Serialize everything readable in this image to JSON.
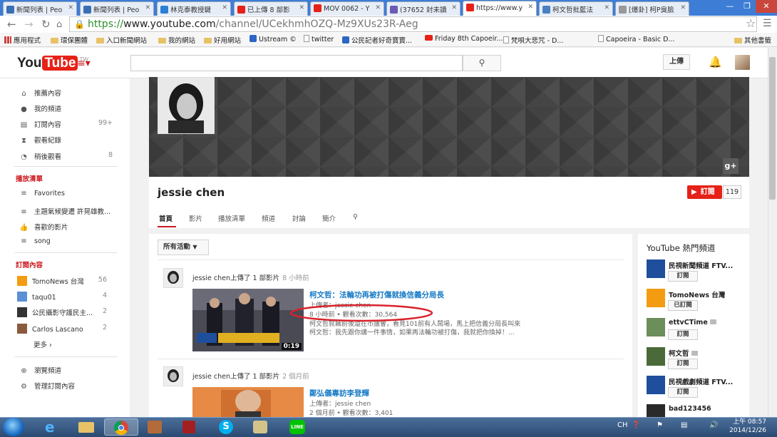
{
  "browser": {
    "tabs": [
      {
        "label": "新聞列表 | Peo",
        "color": "#3b6fb5"
      },
      {
        "label": "新聞列表 | Peo",
        "color": "#3b6fb5"
      },
      {
        "label": "林克泰教授鍵",
        "color": "#2a7fd4"
      },
      {
        "label": "已上傳 8 部影",
        "color": "#e62117"
      },
      {
        "label": "MOV 0062 - Y",
        "color": "#e62117"
      },
      {
        "label": "(37652 封未讀",
        "color": "#6b5bb5"
      },
      {
        "label": "https://www.y",
        "color": "#e62117"
      },
      {
        "label": "柯文哲批藍法",
        "color": "#4a7fc4"
      },
      {
        "label": "[爆卦] 柯P臭臉",
        "color": "#999999"
      }
    ],
    "active_tab_index": 6,
    "url_scheme": "https://",
    "url_host": "www.youtube.com",
    "url_path": "/channel/UCekhmhOZQ-Mz9XUs23R-Aeg",
    "bookmarks": [
      {
        "label": "應用程式",
        "icon": "apps-icon"
      },
      {
        "label": "環保團體",
        "icon": "folder-icon"
      },
      {
        "label": "入口新聞網站",
        "icon": "folder-icon"
      },
      {
        "label": "我的網站",
        "icon": "folder-icon"
      },
      {
        "label": "好用網站",
        "icon": "folder-icon"
      },
      {
        "label": "Ustream ©",
        "icon": "ustream-icon"
      },
      {
        "label": "twitter",
        "icon": "page-icon"
      },
      {
        "label": "公民記者好奇寶寶...",
        "icon": "ustream-icon"
      },
      {
        "label": "Friday 8th Capoeir...",
        "icon": "youtube-icon"
      },
      {
        "label": "梵唄大悲咒 - D...",
        "icon": "page-icon"
      },
      {
        "label": "Capoeira - Basic D...",
        "icon": "page-icon"
      },
      {
        "label": "其他書籤",
        "icon": "folder-icon"
      }
    ]
  },
  "youtube": {
    "logo_you": "You",
    "logo_tube": "Tube",
    "logo_region": "TW",
    "search_placeholder": "",
    "upload_label": "上傳",
    "sidebar": {
      "main_items": [
        {
          "label": "推薦內容",
          "icon": "home-icon",
          "count": ""
        },
        {
          "label": "我的頻道",
          "icon": "user-icon",
          "count": ""
        },
        {
          "label": "訂閱內容",
          "icon": "subscriptions-icon",
          "count": "99+"
        },
        {
          "label": "觀看紀錄",
          "icon": "hourglass-icon",
          "count": ""
        },
        {
          "label": "稍後觀看",
          "icon": "clock-icon",
          "count": "8"
        }
      ],
      "playlists_heading": "播放清單",
      "playlists": [
        {
          "label": "Favorites",
          "icon": "list-icon"
        },
        {
          "label": "主題氣候變遷 許晃雄教...",
          "icon": "list-icon"
        },
        {
          "label": "喜歡的影片",
          "icon": "thumbs-up-icon"
        },
        {
          "label": "song",
          "icon": "list-icon"
        }
      ],
      "subs_heading": "訂閱內容",
      "subscriptions": [
        {
          "label": "TomoNews 台灣",
          "count": "56",
          "color": "#f39c12"
        },
        {
          "label": "taqu01",
          "count": "4",
          "color": "#5b8fd6"
        },
        {
          "label": "公民攝影守護民主...",
          "count": "2",
          "color": "#333333"
        },
        {
          "label": "Carlos Lascano",
          "count": "2",
          "color": "#8b5a3c"
        }
      ],
      "more_label": "更多 ›",
      "browse_channels": "瀏覽頻道",
      "manage_subs": "管理訂閱內容"
    },
    "channel": {
      "name": "jessie chen",
      "subscribe_label": "訂閱",
      "subscriber_count": "119",
      "tabs": [
        "首頁",
        "影片",
        "播放清單",
        "頻道",
        "討論",
        "簡介"
      ],
      "activity_filter": "所有活動"
    },
    "feed": [
      {
        "actor": "jessie chen上傳了 1 部影片",
        "ago": "8 小時前",
        "title": "柯文哲：法輪功再被打傷就換信義分局長",
        "uploader": "上傳者：jessie chen",
        "stats": "8 小時前 • 觀看次數：30,564",
        "desc1": "柯文哲就職前後還在市議會，看見101前有人鬧場，馬上把信義分局長叫來",
        "desc2": "柯文哲：我先跟你講一件事情，如果再法輪功被打傷，我就把你換掉！...",
        "duration": "0:19"
      },
      {
        "actor": "jessie chen上傳了 1 部影片",
        "ago": "2 個月前",
        "title": "鄭弘儀專訪李登輝",
        "uploader": "上傳者：jessie chen",
        "stats": "2 個月前 • 觀看次數：3,401",
        "desc1": "",
        "desc2": "",
        "duration": ""
      }
    ],
    "popular": {
      "title": "YouTube 熱門頻道",
      "channels": [
        {
          "name": "民視新聞頻道 FTV...",
          "button": "訂閱",
          "color": "#1f4e9c"
        },
        {
          "name": "TomoNews 台灣",
          "button": "已訂閱",
          "color": "#f39c12"
        },
        {
          "name": "ettvCTime",
          "button": "訂閱",
          "color": "#6b8e5a"
        },
        {
          "name": "柯文哲",
          "button": "訂閱",
          "color": "#4a6a3a"
        },
        {
          "name": "民視戲劇頻道 FTV...",
          "button": "訂閱",
          "color": "#1f4e9c"
        },
        {
          "name": "bad123456",
          "button": "",
          "color": "#2a2a2a"
        }
      ]
    }
  },
  "taskbar": {
    "language": "CH",
    "time": "上午 08:57",
    "date": "2014/12/26"
  }
}
